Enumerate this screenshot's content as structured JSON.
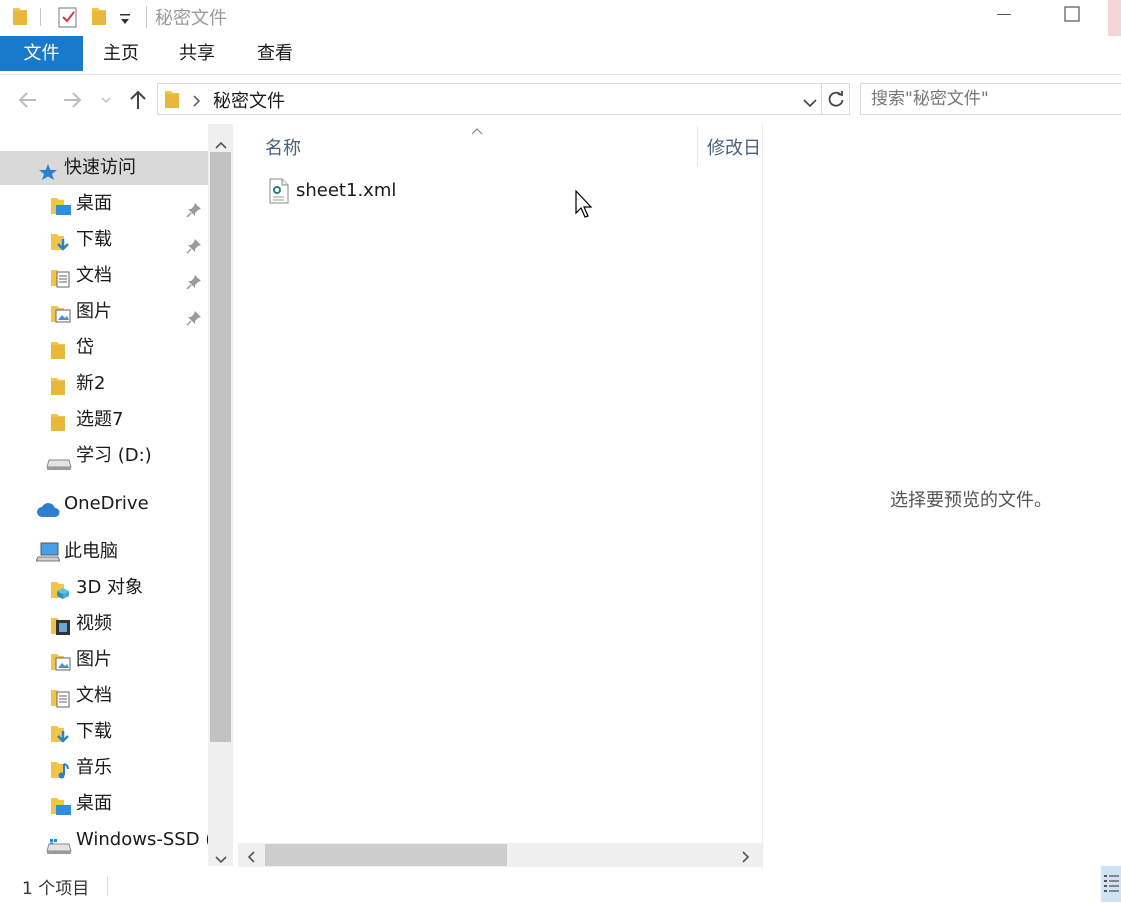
{
  "window": {
    "title": "秘密文件"
  },
  "ribbon": {
    "tabs": [
      {
        "label": "文件",
        "active": true
      },
      {
        "label": "主页"
      },
      {
        "label": "共享"
      },
      {
        "label": "查看"
      }
    ]
  },
  "address_bar": {
    "path": [
      "秘密文件"
    ],
    "search_placeholder": "搜索\"秘密文件\""
  },
  "nav_pane": {
    "quick_access": {
      "label": "快速访问"
    },
    "quick_items": [
      {
        "label": "桌面",
        "icon": "desktop-folder-icon",
        "pinned": true
      },
      {
        "label": "下载",
        "icon": "downloads-folder-icon",
        "pinned": true
      },
      {
        "label": "文档",
        "icon": "documents-folder-icon",
        "pinned": true
      },
      {
        "label": "图片",
        "icon": "pictures-folder-icon",
        "pinned": true
      },
      {
        "label": "岱",
        "icon": "folder-icon"
      },
      {
        "label": "新2",
        "icon": "folder-icon"
      },
      {
        "label": "选题7",
        "icon": "folder-icon"
      },
      {
        "label": "学习 (D:)",
        "icon": "drive-icon"
      }
    ],
    "onedrive": {
      "label": "OneDrive"
    },
    "this_pc": {
      "label": "此电脑"
    },
    "pc_items": [
      {
        "label": "3D 对象",
        "icon": "3d-objects-folder-icon"
      },
      {
        "label": "视频",
        "icon": "videos-folder-icon"
      },
      {
        "label": "图片",
        "icon": "pictures-folder-icon"
      },
      {
        "label": "文档",
        "icon": "documents-folder-icon"
      },
      {
        "label": "下载",
        "icon": "downloads-folder-icon"
      },
      {
        "label": "音乐",
        "icon": "music-folder-icon"
      },
      {
        "label": "桌面",
        "icon": "desktop-folder-icon"
      },
      {
        "label": "Windows-SSD (",
        "icon": "drive-icon"
      }
    ]
  },
  "file_list": {
    "columns": [
      {
        "label": "名称",
        "sorted": "ascending"
      },
      {
        "label": "修改日"
      }
    ],
    "files": [
      {
        "name": "sheet1.xml",
        "icon": "xml-file-icon"
      }
    ]
  },
  "preview_pane": {
    "message": "选择要预览的文件。"
  },
  "status_bar": {
    "item_count": "1 个项目"
  },
  "colors": {
    "accent": "#1979ca",
    "folder": "#f0c54a",
    "selection": "#d9d9d9"
  }
}
